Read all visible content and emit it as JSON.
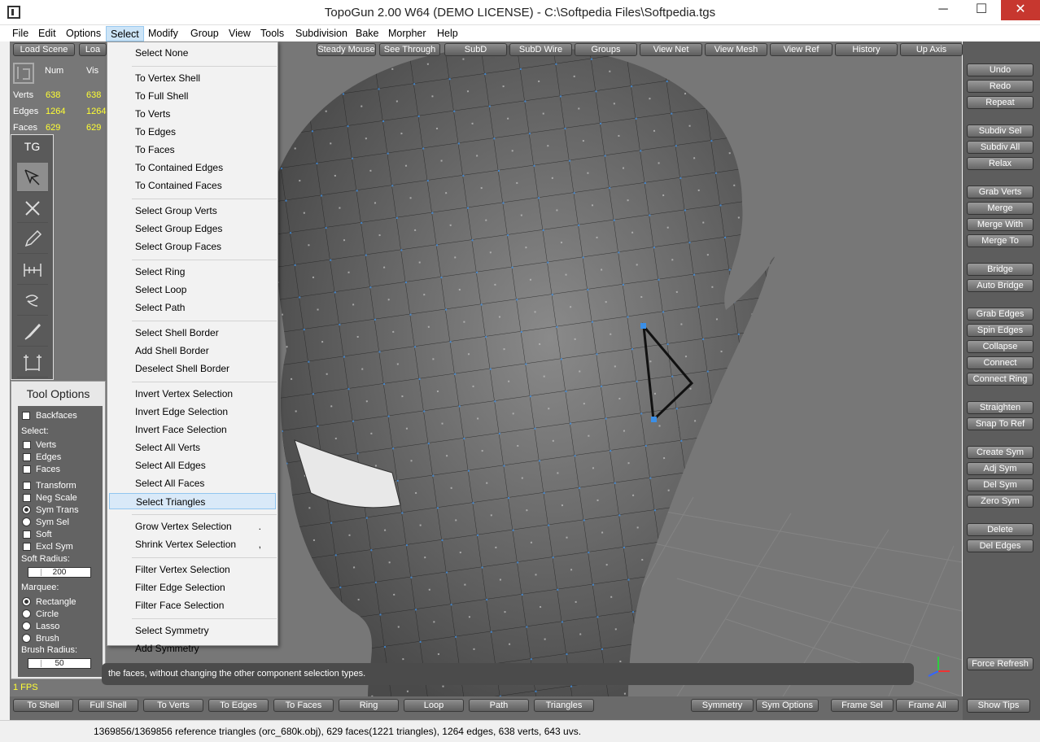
{
  "window": {
    "title": "TopoGun 2.00 W64  (DEMO LICENSE)  - C:\\Softpedia Files\\Softpedia.tgs",
    "minimize": "─",
    "maximize": "☐",
    "close": "✕"
  },
  "menubar": [
    "File",
    "Edit",
    "Options",
    "Select",
    "Modify",
    "Group",
    "View",
    "Tools",
    "Subdivision",
    "Bake",
    "Morpher",
    "Help"
  ],
  "top_toolbar": {
    "left": [
      "Load Scene",
      "Loa"
    ],
    "center": [
      "Steady Mouse",
      "See Through",
      "SubD",
      "SubD Wire",
      "Groups",
      "View Net",
      "View Mesh",
      "View Ref",
      "History",
      "Up Axis"
    ]
  },
  "stats": {
    "headers": [
      "Num",
      "Vis"
    ],
    "rows": [
      {
        "label": "Verts",
        "num": "638",
        "vis": "638"
      },
      {
        "label": "Edges",
        "num": "1264",
        "vis": "1264"
      },
      {
        "label": "Faces",
        "num": "629",
        "vis": "629"
      }
    ]
  },
  "tool_panel": {
    "title": "TG",
    "tools": [
      "select-tool-icon",
      "cut-tool-icon",
      "pencil-tool-icon",
      "bridge-tool-icon",
      "smooth-tool-icon",
      "brush-tool-icon",
      "tweak-tool-icon"
    ]
  },
  "tool_options": {
    "title": "Tool Options",
    "backfaces": "Backfaces",
    "select_label": "Select:",
    "select_items": [
      "Verts",
      "Edges",
      "Faces"
    ],
    "toggles": [
      "Transform",
      "Neg Scale"
    ],
    "sym_trans": "Sym Trans",
    "sym_sel": "Sym Sel",
    "soft": "Soft",
    "excl_sym": "Excl Sym",
    "soft_radius_label": "Soft Radius:",
    "soft_radius": "200",
    "marquee_label": "Marquee:",
    "marquee": [
      "Rectangle",
      "Circle",
      "Lasso",
      "Brush"
    ],
    "marquee_selected": "Rectangle",
    "brush_radius_label": "Brush Radius:",
    "brush_radius": "50"
  },
  "select_menu": {
    "items": [
      [
        "Select None"
      ],
      [
        "To Vertex Shell",
        "To Full Shell",
        "To Verts",
        "To Edges",
        "To Faces",
        "To Contained Edges",
        "To Contained Faces"
      ],
      [
        "Select Group Verts",
        "Select Group Edges",
        "Select Group Faces"
      ],
      [
        "Select Ring",
        "Select Loop",
        "Select Path"
      ],
      [
        "Select Shell Border",
        "Add Shell Border",
        "Deselect Shell Border"
      ],
      [
        "Invert Vertex Selection",
        "Invert Edge Selection",
        "Invert Face Selection",
        "Select All Verts",
        "Select All Edges",
        "Select All Faces",
        "Select Triangles"
      ],
      [
        "Grow Vertex Selection",
        "Shrink Vertex Selection"
      ],
      [
        "Filter Vertex Selection",
        "Filter Edge Selection",
        "Filter Face Selection"
      ],
      [
        "Select Symmetry",
        "Add Symmetry"
      ]
    ],
    "highlighted": "Select Triangles",
    "shortcuts": {
      "Grow Vertex Selection": ".",
      "Shrink Vertex Selection": ","
    }
  },
  "hint": "the faces, without changing the other component selection types.",
  "fps": "1 FPS",
  "right_panel": [
    [
      "Undo",
      "Redo",
      "Repeat"
    ],
    [
      "Subdiv Sel",
      "Subdiv All",
      "Relax"
    ],
    [
      "Grab Verts",
      "Merge",
      "Merge With",
      "Merge To"
    ],
    [
      "Bridge",
      "Auto Bridge"
    ],
    [
      "Grab Edges",
      "Spin Edges",
      "Collapse",
      "Connect",
      "Connect Ring"
    ],
    [
      "Straighten",
      "Snap To Ref"
    ],
    [
      "Create Sym",
      "Adj Sym",
      "Del Sym",
      "Zero Sym"
    ],
    [
      "Delete",
      "Del Edges"
    ]
  ],
  "force_refresh": "Force Refresh",
  "bottom_toolbar": {
    "left": [
      "To Shell",
      "Full Shell",
      "To Verts",
      "To Edges",
      "To Faces",
      "Ring",
      "Loop",
      "Path",
      "Triangles"
    ],
    "right": [
      "Symmetry",
      "Sym Options",
      "Frame Sel",
      "Frame All"
    ],
    "show_tips": "Show Tips"
  },
  "status": "1369856/1369856 reference triangles (orc_680k.obj), 629 faces(1221 triangles), 1264 edges, 638 verts, 643 uvs.",
  "colors": {
    "viewport": "#777777",
    "mesh": "#5f5f5f",
    "vertex": "#3a8fe8",
    "stat_value": "#ffff33",
    "menu_highlight": "#d9e9f8"
  }
}
